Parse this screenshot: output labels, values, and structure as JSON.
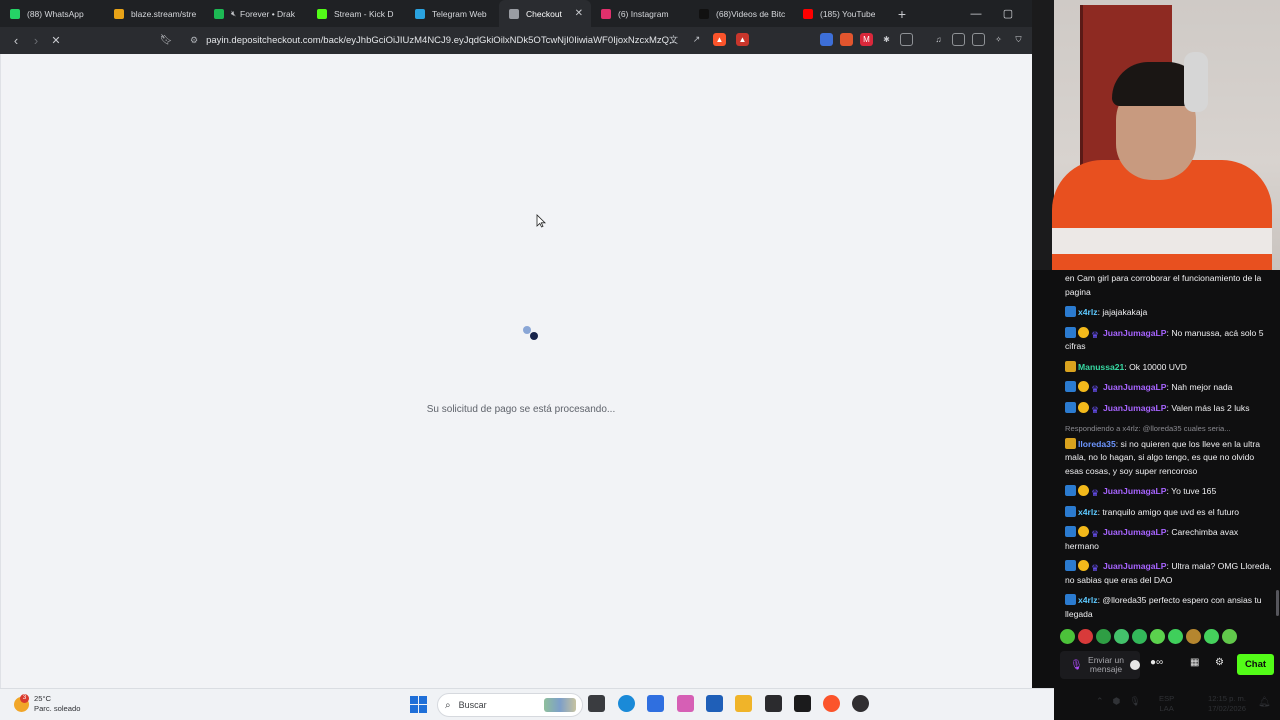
{
  "tabs": [
    {
      "label": "(88) WhatsApp",
      "icon": "whatsapp-icon",
      "color": "#25d366",
      "muted": false
    },
    {
      "label": "blaze.stream/strea",
      "icon": "blaze-icon",
      "color": "#e8a317",
      "muted": false
    },
    {
      "label": "Forever • Drak",
      "icon": "spotify-icon",
      "color": "#1db954",
      "muted": true
    },
    {
      "label": "Stream - Kick D",
      "icon": "kick-icon",
      "color": "#53fc18",
      "muted": false
    },
    {
      "label": "Telegram Web",
      "icon": "telegram-icon",
      "color": "#2aa3e0",
      "muted": false
    },
    {
      "label": "Checkout",
      "icon": "loading-icon",
      "color": "#9a9da3",
      "muted": false,
      "active": true
    },
    {
      "label": "(6) Instagram",
      "icon": "instagram-icon",
      "color": "#e1306c",
      "muted": false
    },
    {
      "label": "(68)Videos de Bitc",
      "icon": "tiktok-icon",
      "color": "#111111",
      "muted": false
    },
    {
      "label": "(185) YouTube",
      "icon": "youtube-icon",
      "color": "#ff0000",
      "muted": false
    }
  ],
  "window": {
    "new_tab": "+",
    "minimize": "—",
    "maximize": "▢",
    "close": "✕"
  },
  "nav": {
    "url": "payin.depositcheckout.com/back/eyJhbGciOiJIUzM4NCJ9.eyJqdGkiOilxNDk5OTcwNjI0IiwiaWF0IjoxNzcxMzQ...",
    "back": "‹",
    "forward": "›",
    "stop": "✕"
  },
  "page": {
    "status_text": "Su solicitud de pago se está procesando..."
  },
  "chat": {
    "messages": [
      {
        "user": "",
        "text": "en Cam girl para corroborar el funcionamiento de la pagina",
        "badges": []
      },
      {
        "user": "x4rlz",
        "text": "jajajakakaja",
        "badges": [
          "kick"
        ],
        "cls": "u-x4"
      },
      {
        "user": "JuanJumagaLP",
        "text": "No manussa, acá solo 5 cifras",
        "badges": [
          "kick",
          "gold",
          "sub"
        ],
        "cls": "u-juan"
      },
      {
        "user": "Manussa21",
        "text": "Ok 10000 UVD",
        "badges": [
          "crown"
        ],
        "cls": "u-man"
      },
      {
        "user": "JuanJumagaLP",
        "text": "Nah mejor nada",
        "badges": [
          "kick",
          "gold",
          "sub"
        ],
        "cls": "u-juan"
      },
      {
        "user": "JuanJumagaLP",
        "text": "Valen más las 2 luks",
        "badges": [
          "kick",
          "gold",
          "sub"
        ],
        "cls": "u-juan"
      },
      {
        "user": "lloreda35",
        "text": "si no quieren que los lleve en la ultra mala, no lo hagan, si algo tengo, es que no olvido esas cosas, y soy super rencoroso",
        "badges": [
          "crown"
        ],
        "cls": "u-llo",
        "reply": "Respondiendo a x4rlz: @lloreda35 cuales seria..."
      },
      {
        "user": "JuanJumagaLP",
        "text": "Yo tuve 165",
        "badges": [
          "kick",
          "gold",
          "sub"
        ],
        "cls": "u-juan"
      },
      {
        "user": "x4rlz",
        "text": "tranquilo amigo que uvd es el futuro",
        "badges": [
          "kick"
        ],
        "cls": "u-x4"
      },
      {
        "user": "JuanJumagaLP",
        "text": "Carechimba avax hermano",
        "badges": [
          "kick",
          "gold",
          "sub"
        ],
        "cls": "u-juan"
      },
      {
        "user": "JuanJumagaLP",
        "text": "Ultra mala? OMG Lloreda, no sabias que eras del DAO",
        "badges": [
          "kick",
          "gold",
          "sub"
        ],
        "cls": "u-juan"
      },
      {
        "user": "x4rlz",
        "text": "@lloreda35 perfecto espero con ansias tu llegada",
        "badges": [
          "kick"
        ],
        "cls": "u-x4"
      }
    ],
    "emote_colors": [
      "#4cc23a",
      "#d83a3a",
      "#2f9e44",
      "#43c26b",
      "#33b85a",
      "#5bd24d",
      "#3fcf5b",
      "#b5862f",
      "#45d15c",
      "#61c84b"
    ],
    "input_placeholder": "Enviar un mensaje",
    "chat_button": "Chat"
  },
  "taskbar": {
    "weather_temp": "25°C",
    "weather_desc": "Parc. soleado",
    "weather_alert": "3",
    "search_placeholder": "Buscar",
    "lang_line1": "ESP",
    "lang_line2": "LAA",
    "time": "12:15 p. m.",
    "date": "17/02/2026",
    "apps": [
      {
        "name": "task-view-icon",
        "color": "#3a3c40"
      },
      {
        "name": "edge-icon",
        "color": "#1a8ad8"
      },
      {
        "name": "snipping-tool-icon",
        "color": "#2f6fe0"
      },
      {
        "name": "copilot-icon",
        "color": "#d65fb5"
      },
      {
        "name": "store-icon",
        "color": "#1f5fb8"
      },
      {
        "name": "file-explorer-icon",
        "color": "#f0b429"
      },
      {
        "name": "terminal-icon",
        "color": "#2b2b2e"
      },
      {
        "name": "app-icon",
        "color": "#1b1b1c"
      },
      {
        "name": "brave-icon",
        "color": "#fb542b"
      },
      {
        "name": "obs-icon",
        "color": "#302e31"
      }
    ]
  }
}
